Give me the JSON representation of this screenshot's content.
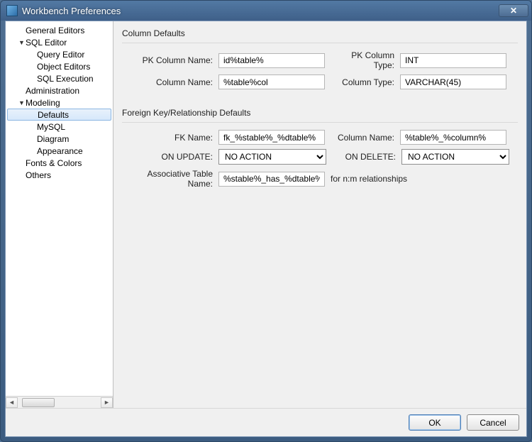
{
  "window": {
    "title": "Workbench Preferences"
  },
  "tree": {
    "items": [
      {
        "label": "General Editors",
        "level": 1,
        "expand": ""
      },
      {
        "label": "SQL Editor",
        "level": 1,
        "expand": "▼"
      },
      {
        "label": "Query Editor",
        "level": 2,
        "expand": ""
      },
      {
        "label": "Object Editors",
        "level": 2,
        "expand": ""
      },
      {
        "label": "SQL Execution",
        "level": 2,
        "expand": ""
      },
      {
        "label": "Administration",
        "level": 1,
        "expand": ""
      },
      {
        "label": "Modeling",
        "level": 1,
        "expand": "▼"
      },
      {
        "label": "Defaults",
        "level": 2,
        "expand": "",
        "selected": true
      },
      {
        "label": "MySQL",
        "level": 2,
        "expand": ""
      },
      {
        "label": "Diagram",
        "level": 2,
        "expand": ""
      },
      {
        "label": "Appearance",
        "level": 2,
        "expand": ""
      },
      {
        "label": "Fonts & Colors",
        "level": 1,
        "expand": ""
      },
      {
        "label": "Others",
        "level": 1,
        "expand": ""
      }
    ]
  },
  "columnDefaults": {
    "title": "Column Defaults",
    "pkNameLabel": "PK Column Name:",
    "pkName": "id%table%",
    "pkTypeLabel": "PK Column Type:",
    "pkType": "INT",
    "colNameLabel": "Column Name:",
    "colName": "%table%col",
    "colTypeLabel": "Column Type:",
    "colType": "VARCHAR(45)"
  },
  "fkDefaults": {
    "title": "Foreign Key/Relationship Defaults",
    "fkNameLabel": "FK Name:",
    "fkName": "fk_%stable%_%dtable%",
    "colNameLabel": "Column Name:",
    "colName": "%table%_%column%",
    "onUpdateLabel": "ON UPDATE:",
    "onUpdate": "NO ACTION",
    "onDeleteLabel": "ON DELETE:",
    "onDelete": "NO ACTION",
    "assocLabel": "Associative Table Name:",
    "assocName": "%stable%_has_%dtable%",
    "assocNote": "for n:m relationships"
  },
  "buttons": {
    "ok": "OK",
    "cancel": "Cancel"
  }
}
